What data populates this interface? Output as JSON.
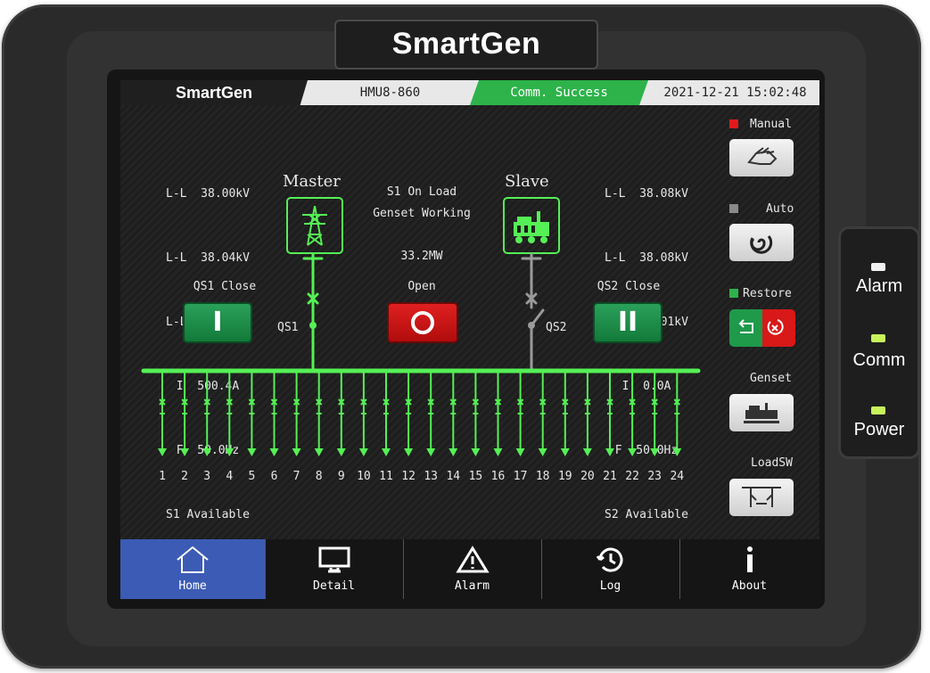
{
  "device": {
    "brand": "SmartGen",
    "colors": {
      "accent_green": "#2db34a",
      "line_green": "#55f055",
      "alarm_red": "#e01a1a",
      "nav_active": "#3b5bb5"
    }
  },
  "status_bar": {
    "brand": "SmartGen",
    "model": "HMU8-860",
    "comm_status": "Comm. Success",
    "datetime": "2021-12-21 15:02:48"
  },
  "master": {
    "title": "Master",
    "readings": [
      "L-L  38.00kV",
      "L-L  38.04kV",
      "L-L  38.05kV",
      "I  500.4A",
      "F  50.0Hz",
      "S1 Available"
    ],
    "switch_state": "QS1 Close",
    "switch_name": "QS1",
    "icon": "transmission-tower-icon"
  },
  "slave": {
    "title": "Slave",
    "readings": [
      "L-L  38.08kV",
      "L-L  38.08kV",
      "L-L  38.01kV",
      "I  0.0A",
      "F  50.0Hz",
      "S2 Available"
    ],
    "switch_state": "QS2 Close",
    "switch_name": "QS2",
    "icon": "generator-icon"
  },
  "center": {
    "status1": "S1 On Load",
    "status2": "Genset Working",
    "power": "33.2MW",
    "open_label": "Open"
  },
  "buttons": {
    "qs1_close_symbol": "I",
    "qs2_close_symbol": "II"
  },
  "feeders": [
    "1",
    "2",
    "3",
    "4",
    "5",
    "6",
    "7",
    "8",
    "9",
    "10",
    "11",
    "12",
    "13",
    "14",
    "15",
    "16",
    "17",
    "18",
    "19",
    "20",
    "21",
    "22",
    "23",
    "24"
  ],
  "side_panel": {
    "manual": {
      "label": "Manual",
      "indicator": "#e01a1a",
      "icon": "hand-icon"
    },
    "auto": {
      "label": "Auto",
      "indicator": "#8a8a8a",
      "icon": "auto-swirl-icon"
    },
    "restore": {
      "label": "Restore",
      "indicator": "#2db34a",
      "icon": "restore-icon"
    },
    "genset": {
      "label": "Genset",
      "icon": "generator-icon"
    },
    "loadsw": {
      "label": "LoadSW",
      "icon": "load-switch-icon"
    }
  },
  "nav": [
    {
      "label": "Home",
      "icon": "home-icon",
      "active": true
    },
    {
      "label": "Detail",
      "icon": "monitor-icon",
      "active": false
    },
    {
      "label": "Alarm",
      "icon": "warning-icon",
      "active": false
    },
    {
      "label": "Log",
      "icon": "history-icon",
      "active": false
    },
    {
      "label": "About",
      "icon": "info-icon",
      "active": false
    }
  ],
  "indicators": [
    {
      "label": "Alarm",
      "color": "#f2f2f2"
    },
    {
      "label": "Comm",
      "color": "#c8f25a"
    },
    {
      "label": "Power",
      "color": "#c8f25a"
    }
  ]
}
